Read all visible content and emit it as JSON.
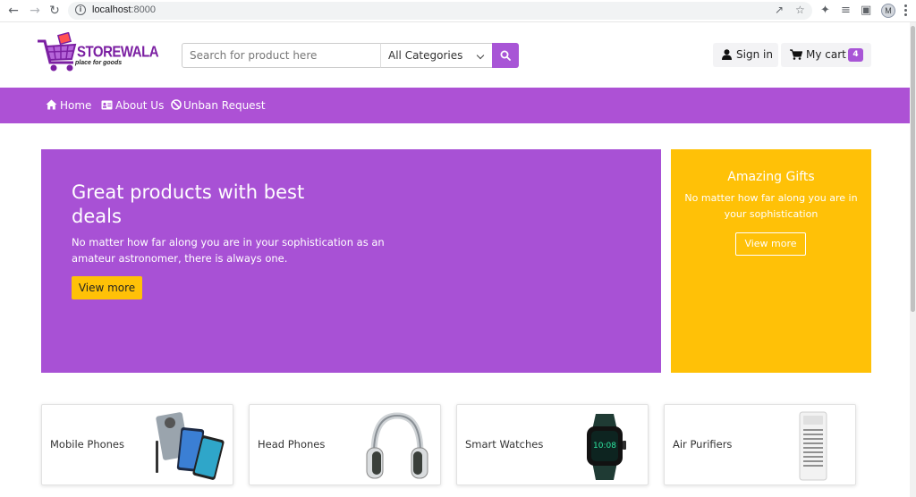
{
  "browser": {
    "url_host": "localhost",
    "url_port": ":8000"
  },
  "header": {
    "logo": {
      "brand": "STOREWALA",
      "tagline": "place for goods"
    },
    "search": {
      "placeholder": "Search for product here",
      "value": ""
    },
    "category_select": {
      "selected": "All Categories"
    },
    "signin_label": "Sign in",
    "cart_label": "My cart",
    "cart_count": "4"
  },
  "nav": {
    "items": [
      {
        "label": "Home",
        "icon": "home-icon"
      },
      {
        "label": "About Us",
        "icon": "id-card-icon"
      },
      {
        "label": "Unban Request",
        "icon": "ban-icon"
      }
    ]
  },
  "hero": {
    "title": "Great products with best deals",
    "text": "No matter how far along you are in your sophistication as an amateur astronomer, there is always one.",
    "button_label": "View more"
  },
  "gift": {
    "title": "Amazing Gifts",
    "text": "No matter how far along you are in your sophistication",
    "button_label": "View more"
  },
  "categories": [
    {
      "label": "Mobile Phones",
      "image": "phones-image"
    },
    {
      "label": "Head Phones",
      "image": "headphones-image"
    },
    {
      "label": "Smart Watches",
      "image": "smartwatch-image"
    },
    {
      "label": "Air Purifiers",
      "image": "air-purifier-image"
    }
  ],
  "colors": {
    "brand_purple": "#ad51d5",
    "accent_yellow": "#ffc107"
  }
}
